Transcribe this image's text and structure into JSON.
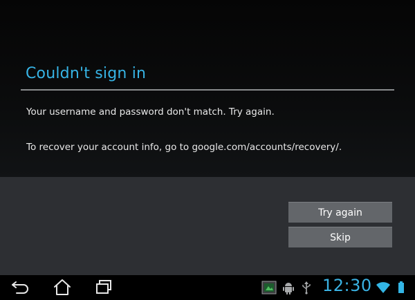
{
  "dialog": {
    "title": "Couldn't sign in",
    "message": "Your username and password don't match. Try again.",
    "recovery": "To recover your account info, go to google.com/accounts/recovery/."
  },
  "buttons": {
    "try_again": "Try again",
    "skip": "Skip"
  },
  "system_bar": {
    "nav_icons": [
      "back-icon",
      "home-icon",
      "recent-apps-icon"
    ],
    "status_icons": [
      "screenshot-icon",
      "android-debug-icon",
      "usb-icon",
      "wifi-icon",
      "battery-icon"
    ],
    "clock": "12:30"
  },
  "colors": {
    "accent": "#37b4e6",
    "clock": "#3ab2e3",
    "button_bg": "#63666a",
    "action_area_bg": "#2d2f33"
  }
}
